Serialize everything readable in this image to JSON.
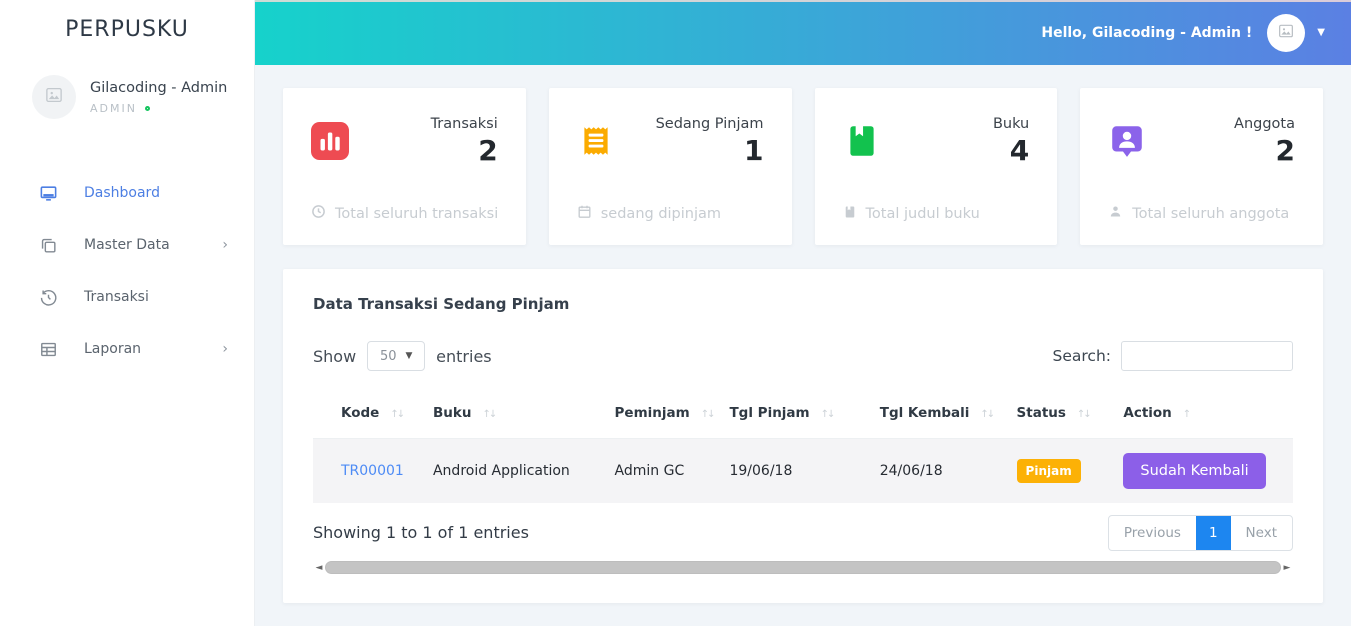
{
  "brand": "PERPUSKU",
  "sidebar": {
    "user": {
      "name": "Gilacoding - Admin",
      "role": "ADMIN"
    },
    "items": [
      {
        "label": "Dashboard",
        "icon": "monitor-icon"
      },
      {
        "label": "Master Data",
        "icon": "copy-icon"
      },
      {
        "label": "Transaksi",
        "icon": "history-icon"
      },
      {
        "label": "Laporan",
        "icon": "table-icon"
      }
    ]
  },
  "topbar": {
    "greeting": "Hello, Gilacoding - Admin !"
  },
  "stats": [
    {
      "label": "Transaksi",
      "value": "2",
      "footer": "Total seluruh transaksi",
      "icon": "bar-chart-icon",
      "color": "#ee4b52"
    },
    {
      "label": "Sedang Pinjam",
      "value": "1",
      "footer": "sedang dipinjam",
      "icon": "receipt-icon",
      "color": "#fbab00"
    },
    {
      "label": "Buku",
      "value": "4",
      "footer": "Total judul buku",
      "icon": "book-icon",
      "color": "#12c24e"
    },
    {
      "label": "Anggota",
      "value": "2",
      "footer": "Total seluruh anggota",
      "icon": "member-icon",
      "color": "#8b63ea"
    }
  ],
  "table_card": {
    "title": "Data Transaksi Sedang Pinjam",
    "show_label": "Show",
    "page_length": "50",
    "entries_label": "entries",
    "search_label": "Search:",
    "columns": {
      "kode": "Kode",
      "buku": "Buku",
      "peminjam": "Peminjam",
      "tgl_pinjam": "Tgl Pinjam",
      "tgl_kembali": "Tgl Kembali",
      "status": "Status",
      "action": "Action"
    },
    "rows": [
      {
        "kode": "TR00001",
        "buku": "Android Application",
        "peminjam": "Admin GC",
        "tgl_pinjam": "19/06/18",
        "tgl_kembali": "24/06/18",
        "status": "Pinjam",
        "action": "Sudah Kembali"
      }
    ],
    "info": "Showing 1 to 1 of 1 entries",
    "pagination": {
      "previous": "Previous",
      "current": "1",
      "next": "Next"
    }
  },
  "colors": {
    "header_gradient_start": "#16d2cb",
    "header_gradient_end": "#5b80e3",
    "active_link": "#4d7fe3",
    "status_badge": "#fcb106",
    "action_button": "#8c5fe8",
    "pagination_active": "#1d86f0",
    "online_dot": "#15c55f"
  }
}
